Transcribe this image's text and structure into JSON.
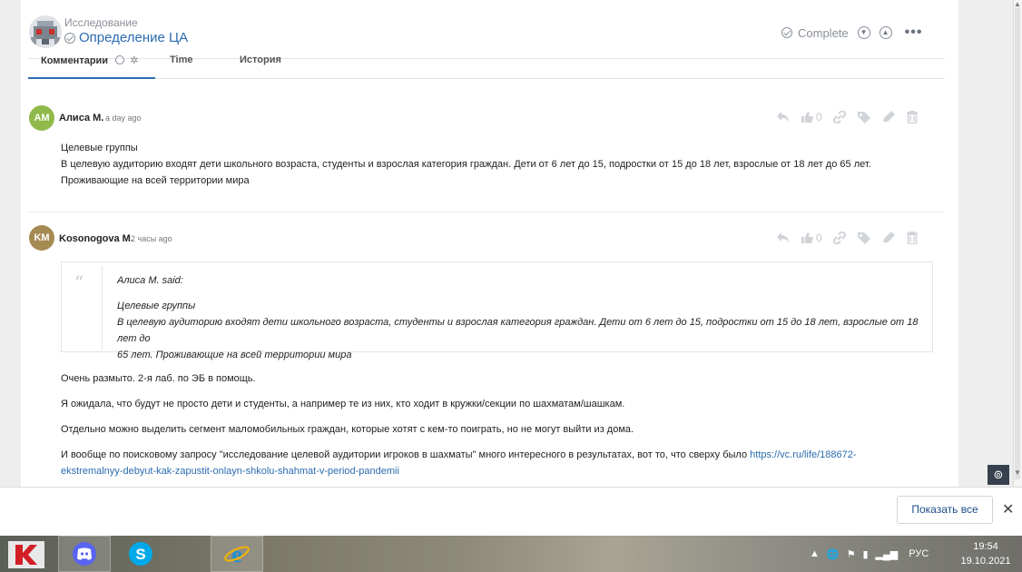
{
  "header": {
    "parent": "Исследование",
    "title": "Определение ЦА",
    "complete_label": "Complete"
  },
  "tabs": [
    {
      "label": "Комментарии"
    },
    {
      "label": "Time"
    },
    {
      "label": "История"
    }
  ],
  "comments": [
    {
      "initials": "AM",
      "avatar_color": "#8fb94a",
      "author": "Алиса М.",
      "time": "a day ago",
      "likes": "0",
      "lines": [
        "Целевые группы",
        "В целевую аудиторию входят дети школьного возраста, студенты и взрослая категория граждан. Дети от 6 лет до 15, подростки от 15 до 18 лет, взрослые от 18 лет до 65 лет.",
        "Проживающие на всей территории мира"
      ]
    },
    {
      "initials": "KM",
      "avatar_color": "#a68a53",
      "author": "Kosonogova M.",
      "time": "2 часы ago",
      "likes": "0",
      "quote": {
        "said": "Алиса М. said:",
        "lines": [
          "Целевые группы",
          "В целевую аудиторию входят дети школьного возраста, студенты и взрослая категория граждан. Дети от 6 лет до 15, подростки от 15 до 18 лет, взрослые от 18 лет до",
          "65 лет. Проживающие на всей территории мира"
        ]
      },
      "paragraphs": [
        "Очень размыто. 2-я лаб. по ЭБ в помощь.",
        "Я ожидала, что будут не просто дети и студенты, а например те из них, кто ходит в кружки/секции по шахматам/шашкам.",
        "Отдельно можно выделить сегмент маломобильных граждан, которые хотят с кем-то поиграть, но не могут выйти из дома."
      ],
      "last_paragraph_text": "И вообще по поисковому запросу \"исследование целевой аудитории игроков в шахматы\" много интересного в результатах, вот то, что сверху было ",
      "link_part1": "https://vc.ru/life/188672-",
      "link_part2": "ekstremalnyy-debyut-kak-zapustit-onlayn-shkolu-shahmat-v-period-pandemii"
    }
  ],
  "notification": {
    "show_all_label": "Показать все",
    "close_label": "✕"
  },
  "taskbar": {
    "language": "РУС",
    "time": "19:54",
    "date": "19.10.2021"
  },
  "colors": {
    "accent": "#2b6cb0",
    "taskbar": "#8d8a78"
  }
}
